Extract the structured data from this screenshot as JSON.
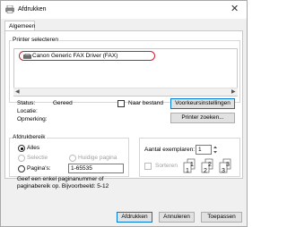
{
  "window": {
    "title": "Afdrukken",
    "close_glyph": "✕"
  },
  "tabs": [
    {
      "label": "Algemeen"
    }
  ],
  "printer_group": {
    "label": "Printer selecteren",
    "printers": [
      {
        "name": "Canon Generic FAX Driver (FAX)",
        "icon": "fax-printer-icon"
      }
    ],
    "selected_highlight_color": "#d0202a"
  },
  "printer_info": {
    "status_label": "Status:",
    "status_value": "Gereed",
    "location_label": "Locatie:",
    "comment_label": "Opmerking:"
  },
  "print_to_file": {
    "label": "Naar bestand",
    "checked": false
  },
  "preferences_button": "Voorkeursinstellingen",
  "find_printer_button": "Printer zoeken...",
  "page_range": {
    "label": "Afdrukbereik",
    "all_label": "Alles",
    "selection_label": "Selectie",
    "current_page_label": "Huidige pagina",
    "pages_label": "Pagina's:",
    "pages_value": "1-65535",
    "hint": "Geef een enkel paginanummer of paginabereik op. Bijvoorbeeld: 5-12",
    "selected": "all"
  },
  "copies": {
    "label": "Aantal exemplaren:",
    "value": "1",
    "collate_label": "Sorteren",
    "collate_checked": false,
    "collate_icon": "collate-pages-icon",
    "page_numbers": [
      "1",
      "1",
      "2",
      "2",
      "3",
      "3"
    ]
  },
  "footer": {
    "print_button": "Afdrukken",
    "cancel_button": "Annuleren",
    "apply_button": "Toepassen"
  },
  "colors": {
    "accent": "#0078d7",
    "window_bg": "#f0f0f0"
  }
}
